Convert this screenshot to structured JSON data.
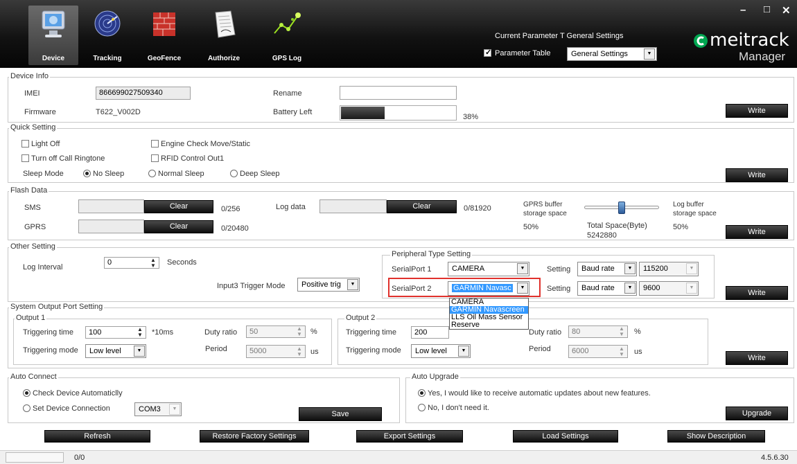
{
  "toolbar": {
    "items": [
      {
        "label": "Device",
        "icon": "device-icon"
      },
      {
        "label": "Tracking",
        "icon": "tracking-icon"
      },
      {
        "label": "GeoFence",
        "icon": "geofence-icon"
      },
      {
        "label": "Authorize",
        "icon": "authorize-icon"
      },
      {
        "label": "GPS Log",
        "icon": "gps-log-icon"
      }
    ],
    "current_param_label": "Current Parameter T General Settings",
    "param_table_label": "Parameter Table",
    "param_table_checked": true,
    "param_select_value": "General Settings"
  },
  "brand": {
    "name": "meitrack",
    "sub": "Manager",
    "accent": "#00a651"
  },
  "window_controls": {
    "minimize": "–",
    "maximize": "□",
    "close": "✕"
  },
  "device_info": {
    "title": "Device Info",
    "imei_label": "IMEI",
    "imei_value": "866699027509340",
    "rename_label": "Rename",
    "rename_value": "",
    "firmware_label": "Firmware",
    "firmware_value": "T622_V002D",
    "battery_label": "Battery Left",
    "battery_percent": 38,
    "battery_text": "38%",
    "write": "Write"
  },
  "quick_setting": {
    "title": "Quick Setting",
    "light_off": "Light Off",
    "engine_check": "Engine Check Move/Static",
    "turn_off_ringtone": "Turn off Call Ringtone",
    "rfid": "RFID Control Out1",
    "sleep_mode_label": "Sleep Mode",
    "sleep_options": [
      "No Sleep",
      "Normal Sleep",
      "Deep Sleep"
    ],
    "sleep_selected": "No Sleep",
    "write": "Write"
  },
  "flash_data": {
    "title": "Flash Data",
    "sms_label": "SMS",
    "sms_count": "0/256",
    "gprs_label": "GPRS",
    "gprs_count": "0/20480",
    "log_data_label": "Log data",
    "log_count": "0/81920",
    "clear": "Clear",
    "gprs_buffer_label_1": "GPRS buffer",
    "gprs_buffer_label_2": "storage space",
    "gprs_buffer_percent": "50%",
    "log_buffer_label_1": "Log buffer",
    "log_buffer_label_2": "storage space",
    "log_buffer_percent": "50%",
    "slider_level": 0.5,
    "total_space_label": "Total Space(Byte)",
    "total_space_value": "5242880",
    "write": "Write"
  },
  "other_setting": {
    "title": "Other Setting",
    "log_interval_label": "Log Interval",
    "log_interval_value": "0",
    "seconds": "Seconds",
    "input3_label": "Input3 Trigger Mode",
    "input3_value": "Positive trig",
    "peripheral_title": "Peripheral Type Setting",
    "serial1_label": "SerialPort 1",
    "serial1_value": "CAMERA",
    "serial2_label": "SerialPort 2",
    "serial2_value": "GARMIN Navasc",
    "setting_label": "Setting",
    "baud_label": "Baud rate",
    "baud1_value": "115200",
    "baud2_value": "9600",
    "dropdown_options": [
      "CAMERA",
      "GARMIN Navascreen",
      "LLS Oil Mass Sensor",
      "Reserve"
    ],
    "dropdown_selected": "GARMIN Navascreen",
    "write": "Write"
  },
  "output_port": {
    "title": "System Output Port Setting",
    "output1_title": "Output 1",
    "output2_title": "Output 2",
    "triggering_time_label": "Triggering time",
    "output1_time": "100",
    "output2_time": "200",
    "unit_10ms": "*10ms",
    "duty_ratio_label": "Duty ratio",
    "output1_duty": "50",
    "output2_duty": "80",
    "duty_ratio_label_2": "Duty ratio",
    "percent": "%",
    "triggering_mode_label": "Triggering mode",
    "output1_mode": "Low level",
    "output2_mode": "Low level",
    "period_label": "Period",
    "output1_period": "5000",
    "output2_period": "6000",
    "us": "us",
    "write": "Write"
  },
  "auto_connect": {
    "title": "Auto Connect",
    "check_auto": "Check Device Automaticlly",
    "set_connection": "Set Device Connection",
    "com_value": "COM3",
    "save": "Save"
  },
  "auto_upgrade": {
    "title": "Auto Upgrade",
    "yes": "Yes, I would like to receive automatic updates about new features.",
    "no": "No, I don't need it.",
    "upgrade": "Upgrade"
  },
  "bottom_buttons": {
    "refresh": "Refresh",
    "restore": "Restore Factory Settings",
    "export": "Export Settings",
    "load": "Load Settings",
    "show_description": "Show Description"
  },
  "status": {
    "progress": "0/0",
    "version": "4.5.6.30"
  }
}
